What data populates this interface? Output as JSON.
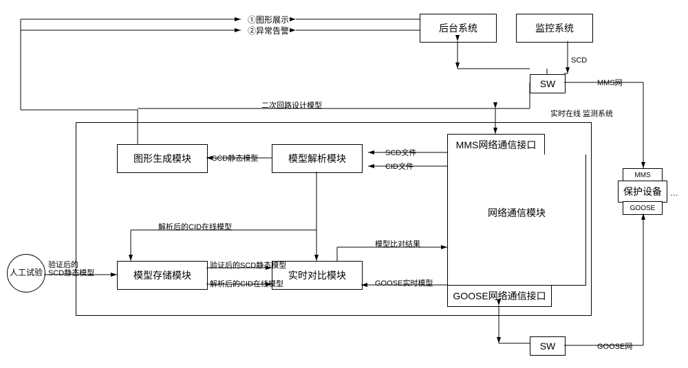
{
  "nodes": {
    "backend_system": "后台系统",
    "monitor_system": "监控系统",
    "sw_top": "SW",
    "sw_bottom": "SW",
    "protect_device": "保护设备",
    "mms_tag": "MMS",
    "goose_tag": "GOOSE",
    "manual_test": "人工试验",
    "online_system": "实时在线\n监测系统",
    "graph_gen": "图形生成模块",
    "model_parse": "模型解析模块",
    "net_comm": "网络通信模块",
    "mms_if": "MMS网络通信接口",
    "goose_if": "GOOSE网络通信接口",
    "model_store": "模型存储模块",
    "rt_compare": "实时对比模块"
  },
  "labels": {
    "display1": "①图形展示",
    "display2": "②异常告警",
    "scd": "SCD",
    "mms_net": "MMS网",
    "goose_net": "GOOSE网",
    "sec_loop": "二次回路设计模型",
    "scd_static": "SCD静态模型",
    "scd_file": "SCD文件",
    "cid_file": "CID文件",
    "verified_scd": "验证后的\nSCD静态模型",
    "parsed_cid": "解析后的CID在线模型",
    "verified_scd2": "验证后的SCD静态模型",
    "parsed_cid2": "解析后的CID在线模型",
    "compare_result": "模型比对结果",
    "goose_rt": "GOOSE实时模型",
    "dots": "…"
  }
}
